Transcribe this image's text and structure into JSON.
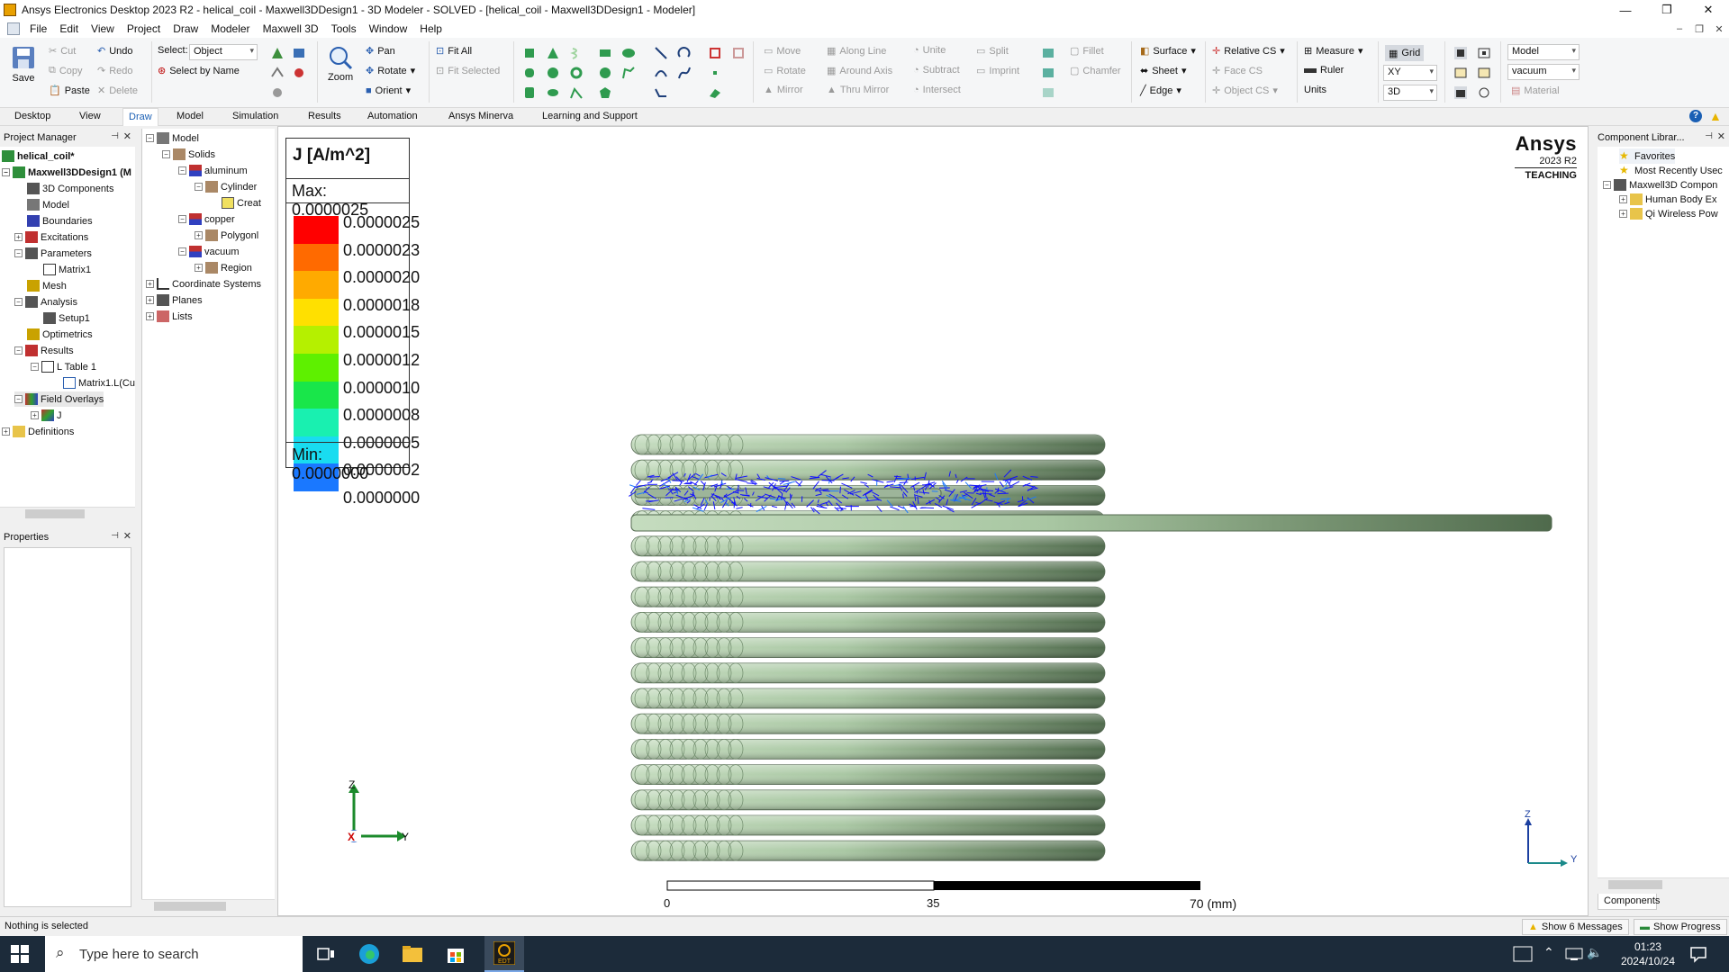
{
  "window": {
    "title": "Ansys Electronics Desktop 2023 R2 - helical_coil - Maxwell3DDesign1 - 3D Modeler - SOLVED - [helical_coil - Maxwell3DDesign1 - Modeler]"
  },
  "menu": [
    "File",
    "Edit",
    "View",
    "Project",
    "Draw",
    "Modeler",
    "Maxwell 3D",
    "Tools",
    "Window",
    "Help"
  ],
  "ribbon": {
    "save": "Save",
    "cut": "Cut",
    "copy": "Copy",
    "paste": "Paste",
    "undo": "Undo",
    "redo": "Redo",
    "delete": "Delete",
    "select_label": "Select:",
    "select_value": "Object",
    "select_by_name": "Select by Name",
    "zoom": "Zoom",
    "pan": "Pan",
    "rotate": "Rotate",
    "orient": "Orient",
    "fit_all": "Fit All",
    "fit_selected": "Fit Selected",
    "move": "Move",
    "rotate2": "Rotate",
    "mirror": "Mirror",
    "along_line": "Along Line",
    "around_axis": "Around Axis",
    "thru_mirror": "Thru Mirror",
    "unite": "Unite",
    "subtract": "Subtract",
    "intersect": "Intersect",
    "split": "Split",
    "imprint": "Imprint",
    "fillet": "Fillet",
    "chamfer": "Chamfer",
    "surface": "Surface",
    "sheet": "Sheet",
    "edge": "Edge",
    "relative_cs": "Relative CS",
    "face_cs": "Face CS",
    "object_cs": "Object CS",
    "measure": "Measure",
    "ruler": "Ruler",
    "units": "Units",
    "grid": "Grid",
    "plane_value": "XY",
    "dim_value": "3D",
    "model_value": "Model",
    "material_value": "vacuum",
    "material": "Material"
  },
  "ribbon_tabs": [
    "Desktop",
    "View",
    "Draw",
    "Model",
    "Simulation",
    "Results",
    "Automation",
    "Ansys Minerva",
    "Learning and Support"
  ],
  "project_manager": {
    "header": "Project Manager",
    "items": [
      "helical_coil*",
      "Maxwell3DDesign1 (M",
      "3D Components",
      "Model",
      "Boundaries",
      "Excitations",
      "Parameters",
      "Matrix1",
      "Mesh",
      "Analysis",
      "Setup1",
      "Optimetrics",
      "Results",
      "L Table 1",
      "Matrix1.L(Cu",
      "Field Overlays",
      "J",
      "Definitions"
    ]
  },
  "properties": {
    "header": "Properties"
  },
  "model_tree": {
    "items": [
      "Model",
      "Solids",
      "aluminum",
      "Cylinder",
      "Creat",
      "copper",
      "Polygonl",
      "vacuum",
      "Region",
      "Coordinate Systems",
      "Planes",
      "Lists"
    ]
  },
  "legend": {
    "title": "J [A/m^2]",
    "max": "Max: 0.0000025",
    "min": "Min: 0.0000000",
    "levels": [
      "0.0000025",
      "0.0000023",
      "0.0000020",
      "0.0000018",
      "0.0000015",
      "0.0000012",
      "0.0000010",
      "0.0000008",
      "0.0000005",
      "0.0000002",
      "0.0000000"
    ],
    "colors": [
      "#ff0000",
      "#ff6a00",
      "#ffaa00",
      "#ffe000",
      "#b5f000",
      "#5ef000",
      "#19e64a",
      "#19f0b0",
      "#19dcf0",
      "#1a78ff",
      "#1010ff"
    ]
  },
  "logo": {
    "brand": "Ansys",
    "version": "2023 R2",
    "edition": "TEACHING"
  },
  "axes": {
    "z": "Z",
    "y": "Y",
    "x": "X"
  },
  "scale": {
    "tick0": "0",
    "tick1": "35",
    "tick2": "70 (mm)"
  },
  "component_library": {
    "header": "Component Librar...",
    "items": [
      "Favorites",
      "Most Recently Usec",
      "Maxwell3D Compon",
      "Human Body Ex",
      "Qi Wireless Pow"
    ],
    "tab": "Components"
  },
  "status": {
    "text": "Nothing is selected",
    "messages": "Show 6 Messages",
    "progress": "Show Progress"
  },
  "taskbar": {
    "search_placeholder": "Type here to search",
    "time": "01:23",
    "date": "2024/10/24"
  }
}
